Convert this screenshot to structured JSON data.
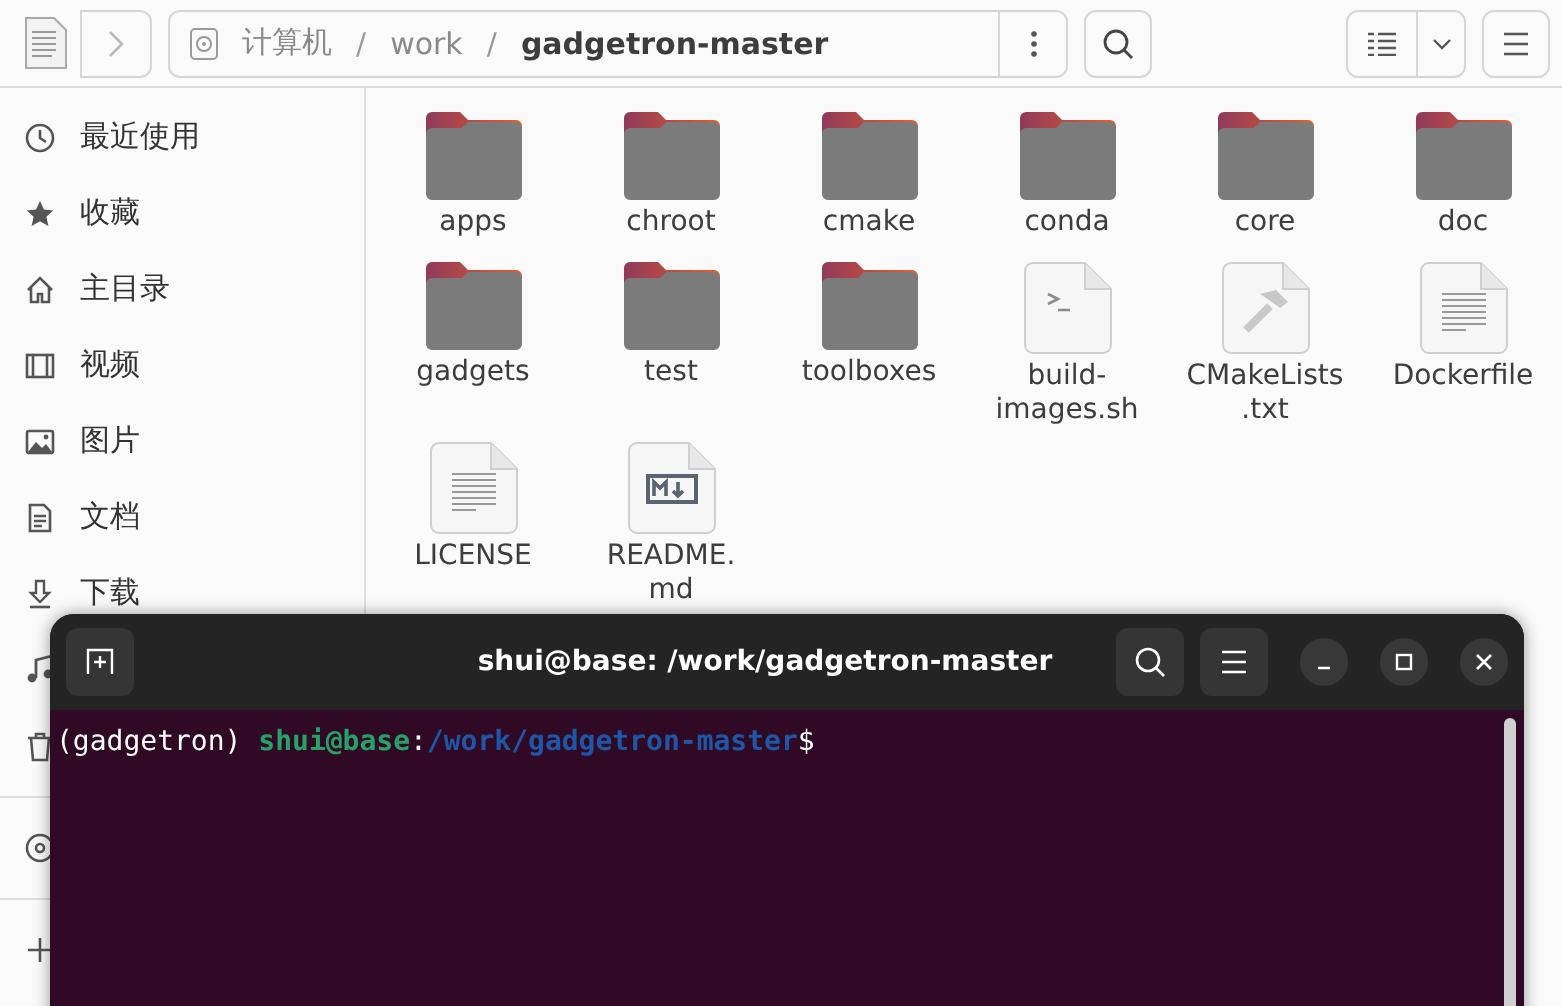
{
  "header": {
    "path_segments": [
      {
        "label": "计算机",
        "selected": false
      },
      {
        "separator": "/",
        "label": "work",
        "selected": false
      },
      {
        "separator": "/",
        "label": "gadgetron-master",
        "selected": true
      }
    ]
  },
  "sidebar": {
    "items": [
      {
        "label": "最近使用",
        "kind": "recent"
      },
      {
        "label": "收藏",
        "kind": "starred"
      },
      {
        "label": "主目录",
        "kind": "home"
      },
      {
        "label": "视频",
        "kind": "videos"
      },
      {
        "label": "图片",
        "kind": "pictures"
      },
      {
        "label": "文档",
        "kind": "documents"
      },
      {
        "label": "下载",
        "kind": "downloads"
      }
    ]
  },
  "files": [
    {
      "name_lines": [
        "apps"
      ],
      "kind": "folder"
    },
    {
      "name_lines": [
        "chroot"
      ],
      "kind": "folder"
    },
    {
      "name_lines": [
        "cmake"
      ],
      "kind": "folder"
    },
    {
      "name_lines": [
        "conda"
      ],
      "kind": "folder"
    },
    {
      "name_lines": [
        "core"
      ],
      "kind": "folder"
    },
    {
      "name_lines": [
        "doc"
      ],
      "kind": "folder"
    },
    {
      "name_lines": [
        "gadgets"
      ],
      "kind": "folder"
    },
    {
      "name_lines": [
        "test"
      ],
      "kind": "folder"
    },
    {
      "name_lines": [
        "toolboxes"
      ],
      "kind": "folder"
    },
    {
      "name_lines": [
        "build-",
        "images.sh"
      ],
      "kind": "script"
    },
    {
      "name_lines": [
        "CMakeLists",
        ".txt"
      ],
      "kind": "cmake"
    },
    {
      "name_lines": [
        "Dockerfile"
      ],
      "kind": "text"
    },
    {
      "name_lines": [
        "LICENSE"
      ],
      "kind": "text"
    },
    {
      "name_lines": [
        "README.",
        "md"
      ],
      "kind": "markdown"
    }
  ],
  "terminal": {
    "title": "shui@base: /work/gadgetron-master",
    "prompt": [
      {
        "text": "(gadgetron) ",
        "kind": "plain"
      },
      {
        "text": "shui@base",
        "kind": "user"
      },
      {
        "text": ":",
        "kind": "plain"
      },
      {
        "text": "/work/gadgetron-master",
        "kind": "path"
      },
      {
        "text": "$",
        "kind": "plain"
      }
    ]
  }
}
